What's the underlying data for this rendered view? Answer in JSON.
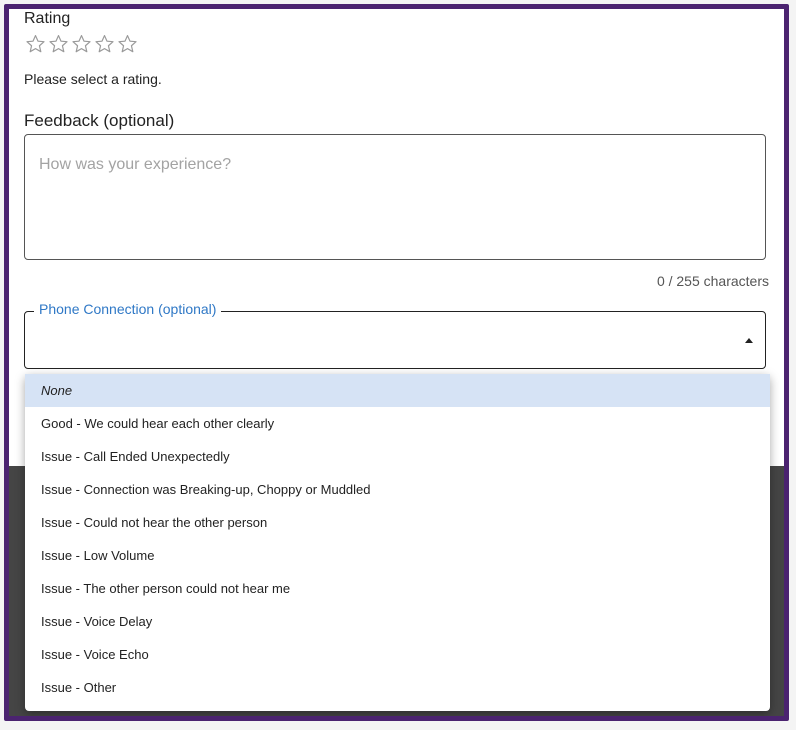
{
  "rating": {
    "label": "Rating",
    "value": 0,
    "max": 5,
    "message": "Please select a rating."
  },
  "feedback": {
    "label": "Feedback (optional)",
    "placeholder": "How was your experience?",
    "value": "",
    "char_count": "0 / 255 characters"
  },
  "phone_connection": {
    "label": "Phone Connection (optional)",
    "value": "",
    "caret_icon": "caret-up-icon"
  },
  "menu": {
    "options": [
      "None",
      "Good - We could hear each other clearly",
      "Issue - Call Ended Unexpectedly",
      "Issue - Connection was Breaking-up, Choppy or Muddled",
      "Issue - Could not hear the other person",
      "Issue - Low Volume",
      "Issue - The other person could not hear me",
      "Issue - Voice Delay",
      "Issue - Voice Echo",
      "Issue - Other"
    ],
    "highlighted_option": "None"
  },
  "colors": {
    "frame_border": "#4b2370",
    "accent": "#2f78c6",
    "highlight": "#d6e3f5",
    "backdrop": "#454545",
    "star_outline": "#9a9a9a"
  }
}
